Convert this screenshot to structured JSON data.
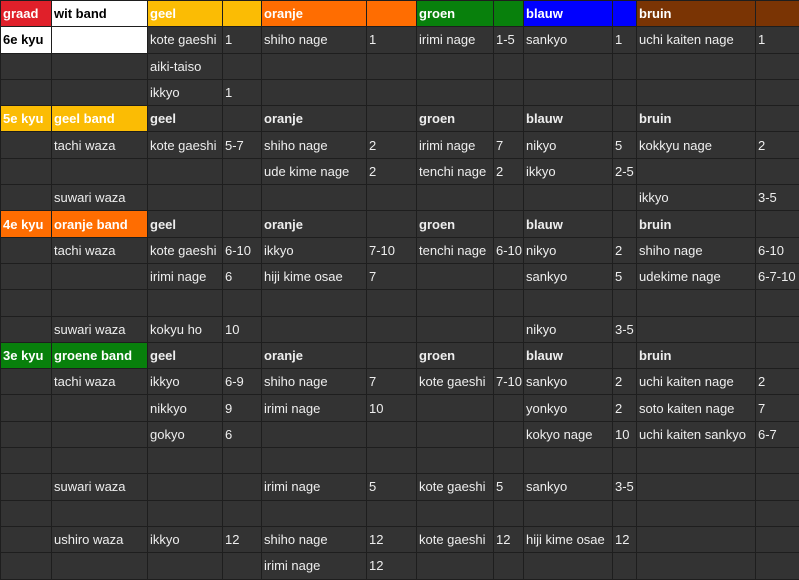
{
  "colors": {
    "graad": "#e0202a",
    "wit": "#ffffff",
    "geel": "#fbbc04",
    "oranje": "#ff6d01",
    "groen": "#08800c",
    "blauw": "#0000ff",
    "bruin": "#7a3404",
    "cell": "#333333"
  },
  "rows": [
    {
      "type": "header",
      "cells": [
        "graad",
        "wit band",
        "geel",
        "",
        "oranje",
        "",
        "groen",
        "",
        "blauw",
        "",
        "bruin",
        ""
      ]
    },
    {
      "type": "kyu6",
      "cells": [
        "6e kyu",
        "",
        "kote gaeshi",
        "1",
        "shiho nage",
        "1",
        "irimi nage",
        "1-5",
        "sankyo",
        "1",
        "uchi kaiten nage",
        "1"
      ]
    },
    {
      "type": "normal",
      "cells": [
        "",
        "",
        "aiki-taiso",
        "",
        "",
        "",
        "",
        "",
        "",
        "",
        "",
        ""
      ]
    },
    {
      "type": "normal",
      "cells": [
        "",
        "",
        "ikkyo",
        "1",
        "",
        "",
        "",
        "",
        "",
        "",
        "",
        ""
      ]
    },
    {
      "type": "section",
      "color": "geel",
      "cells": [
        "5e kyu",
        "geel band",
        "geel",
        "",
        "oranje",
        "",
        "groen",
        "",
        "blauw",
        "",
        "bruin",
        ""
      ]
    },
    {
      "type": "normal",
      "cells": [
        "",
        "tachi waza",
        "kote gaeshi",
        "5-7",
        "shiho nage",
        "2",
        "irimi nage",
        "7",
        "nikyo",
        "5",
        "kokkyu nage",
        "2"
      ]
    },
    {
      "type": "normal",
      "cells": [
        "",
        "",
        "",
        "",
        "ude kime nage",
        "2",
        "tenchi nage",
        "2",
        "ikkyo",
        "2-5",
        "",
        ""
      ]
    },
    {
      "type": "normal",
      "cells": [
        "",
        "suwari waza",
        "",
        "",
        "",
        "",
        "",
        "",
        "",
        "",
        "ikkyo",
        "3-5"
      ]
    },
    {
      "type": "section",
      "color": "oranje",
      "cells": [
        "4e kyu",
        "oranje band",
        "geel",
        "",
        "oranje",
        "",
        "groen",
        "",
        "blauw",
        "",
        "bruin",
        ""
      ]
    },
    {
      "type": "normal",
      "cells": [
        "",
        "tachi waza",
        "kote gaeshi",
        "6-10",
        "ikkyo",
        "7-10",
        "tenchi nage",
        "6-10",
        "nikyo",
        "2",
        "shiho nage",
        "6-10"
      ]
    },
    {
      "type": "normal",
      "cells": [
        "",
        "",
        "irimi nage",
        "6",
        "hiji kime osae",
        "7",
        "",
        "",
        "sankyo",
        "5",
        "udekime nage",
        "6-7-10"
      ]
    },
    {
      "type": "normal",
      "cells": [
        "",
        "",
        "",
        "",
        "",
        "",
        "",
        "",
        "",
        "",
        "",
        ""
      ]
    },
    {
      "type": "normal",
      "cells": [
        "",
        "suwari waza",
        "kokyu ho",
        "10",
        "",
        "",
        "",
        "",
        "nikyo",
        "3-5",
        "",
        ""
      ]
    },
    {
      "type": "section",
      "color": "groen",
      "cells": [
        "3e kyu",
        "groene band",
        "geel",
        "",
        "oranje",
        "",
        "groen",
        "",
        "blauw",
        "",
        "bruin",
        ""
      ]
    },
    {
      "type": "normal",
      "cells": [
        "",
        "tachi waza",
        "ikkyo",
        "6-9",
        "shiho nage",
        "7",
        "kote gaeshi",
        "7-10",
        "sankyo",
        "2",
        "uchi kaiten nage",
        "2"
      ]
    },
    {
      "type": "normal",
      "cells": [
        "",
        "",
        "nikkyo",
        "9",
        "irimi nage",
        "10",
        "",
        "",
        "yonkyo",
        "2",
        "soto kaiten nage",
        "7"
      ]
    },
    {
      "type": "normal",
      "cells": [
        "",
        "",
        "gokyo",
        "6",
        "",
        "",
        "",
        "",
        "kokyo nage",
        "10",
        "uchi kaiten sankyo",
        "6-7"
      ]
    },
    {
      "type": "normal",
      "cells": [
        "",
        "",
        "",
        "",
        "",
        "",
        "",
        "",
        "",
        "",
        "",
        ""
      ]
    },
    {
      "type": "normal",
      "cells": [
        "",
        "suwari waza",
        "",
        "",
        "irimi nage",
        "5",
        "kote gaeshi",
        "5",
        "sankyo",
        "3-5",
        "",
        ""
      ]
    },
    {
      "type": "normal",
      "cells": [
        "",
        "",
        "",
        "",
        "",
        "",
        "",
        "",
        "",
        "",
        "",
        ""
      ]
    },
    {
      "type": "normal",
      "cells": [
        "",
        "ushiro waza",
        "ikkyo",
        "12",
        "shiho nage",
        "12",
        "kote gaeshi",
        "12",
        "hiji kime osae",
        "12",
        "",
        ""
      ]
    },
    {
      "type": "normal",
      "cells": [
        "",
        "",
        "",
        "",
        "irimi nage",
        "12",
        "",
        "",
        "",
        "",
        "",
        ""
      ]
    }
  ]
}
